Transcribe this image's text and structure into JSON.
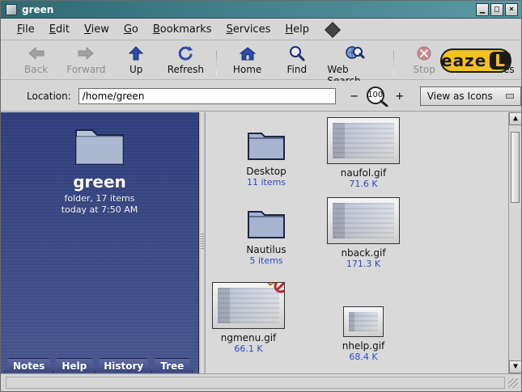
{
  "window": {
    "title": "green"
  },
  "menubar": {
    "items": [
      {
        "label": "File",
        "u": "F",
        "rest": "ile"
      },
      {
        "label": "Edit",
        "u": "E",
        "rest": "dit"
      },
      {
        "label": "View",
        "u": "V",
        "rest": "iew"
      },
      {
        "label": "Go",
        "u": "G",
        "rest": "o"
      },
      {
        "label": "Bookmarks",
        "u": "B",
        "rest": "ookmarks"
      },
      {
        "label": "Services",
        "u": "S",
        "rest": "ervices"
      },
      {
        "label": "Help",
        "u": "H",
        "rest": "elp"
      }
    ]
  },
  "toolbar": {
    "buttons": [
      {
        "label": "Back",
        "icon": "back-arrow-icon",
        "disabled": true
      },
      {
        "label": "Forward",
        "icon": "forward-arrow-icon",
        "disabled": true
      },
      {
        "label": "Up",
        "icon": "up-arrow-icon",
        "disabled": false
      },
      {
        "label": "Refresh",
        "icon": "refresh-icon",
        "disabled": false
      },
      {
        "label": "Home",
        "icon": "home-icon",
        "disabled": false
      },
      {
        "label": "Find",
        "icon": "find-icon",
        "disabled": false
      },
      {
        "label": "Web Search",
        "icon": "web-search-icon",
        "disabled": false
      },
      {
        "label": "Stop",
        "icon": "stop-icon",
        "disabled": true
      },
      {
        "label": "Services",
        "icon": "services-icon",
        "disabled": false
      }
    ],
    "brand": {
      "text": "eaze",
      "suffix": "L"
    }
  },
  "location": {
    "label": "Location:",
    "value": "/home/green",
    "zoom": "100",
    "view_as": "View as Icons"
  },
  "sidebar": {
    "title": "green",
    "meta_line1": "folder, 17 items",
    "meta_line2": "today at 7:50 AM",
    "tabs": [
      "Notes",
      "Help",
      "History",
      "Tree"
    ]
  },
  "files": [
    {
      "name": "Desktop",
      "sub": "11 items",
      "type": "folder"
    },
    {
      "name": "naufol.gif",
      "sub": "71.6 K",
      "type": "image"
    },
    {
      "name": "Nautilus",
      "sub": "5 items",
      "type": "folder"
    },
    {
      "name": "nback.gif",
      "sub": "171.3 K",
      "type": "image"
    },
    {
      "name": "ngmenu.gif",
      "sub": "66.1 K",
      "type": "image",
      "emblem": true
    },
    {
      "name": "nhelp.gif",
      "sub": "68.4 K",
      "type": "image_small"
    }
  ]
}
